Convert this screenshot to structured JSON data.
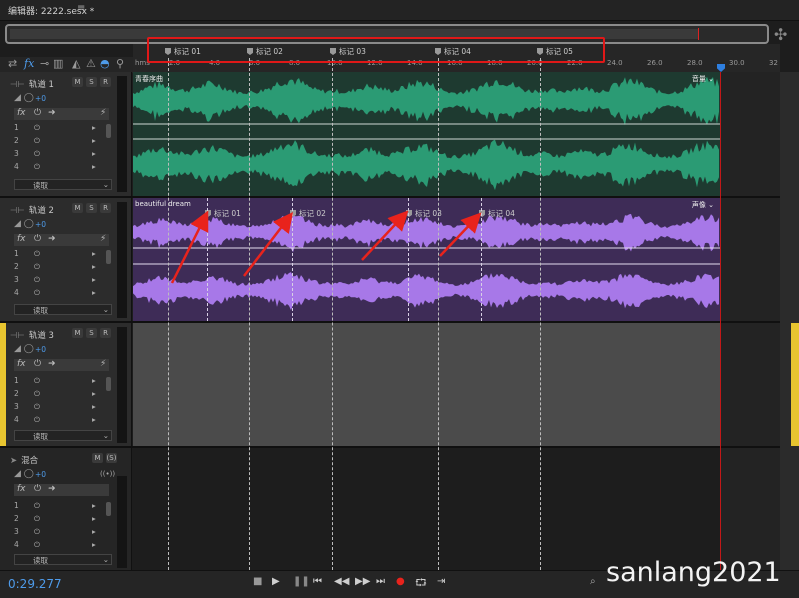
{
  "window": {
    "title": "编辑器: 2222.sesx *",
    "menu_icon": "hamburger-icon"
  },
  "timeline": {
    "unit": "hms",
    "ticks": [
      "2.0",
      "4.0",
      "6.0",
      "8.0",
      "10.0",
      "12.0",
      "14.0",
      "16.0",
      "18.0",
      "20.0",
      "22.0",
      "24.0",
      "26.0",
      "28.0",
      "30.0",
      "32"
    ]
  },
  "markers": [
    {
      "label": "标记 01"
    },
    {
      "label": "标记 02"
    },
    {
      "label": "标记 03"
    },
    {
      "label": "标记 04"
    },
    {
      "label": "标记 05"
    }
  ],
  "tracks": [
    {
      "name": "轨道 1",
      "volume": "+0",
      "buttons": [
        "M",
        "S",
        "R"
      ],
      "slots": [
        "1",
        "2",
        "3",
        "4"
      ],
      "read": "读取",
      "clip_label": "青春序曲",
      "clip_vol": "音量",
      "color": "#2b9b74",
      "bg": "#1f3a30"
    },
    {
      "name": "轨道 2",
      "volume": "+0",
      "buttons": [
        "M",
        "S",
        "R"
      ],
      "slots": [
        "1",
        "2",
        "3",
        "4"
      ],
      "read": "读取",
      "clip_label": "beautiful dream",
      "clip_vol": "声像",
      "color": "#a778e8",
      "bg": "#3e2c57",
      "clip_markers": [
        {
          "label": "标记 01"
        },
        {
          "label": "标记 02"
        },
        {
          "label": "标记 03"
        },
        {
          "label": "标记 04"
        }
      ]
    },
    {
      "name": "轨道 3",
      "volume": "+0",
      "buttons": [
        "M",
        "S",
        "R"
      ],
      "slots": [
        "1",
        "2",
        "3",
        "4"
      ],
      "read": "读取",
      "color": "#5a5a5a",
      "bg": "#4a4a4a"
    },
    {
      "name": "混合",
      "volume": "+0",
      "buttons": [
        "M",
        "(S)"
      ],
      "slots": [
        "1",
        "2",
        "3",
        "4"
      ],
      "read": "读取",
      "color": "#1e1e1e",
      "bg": "#1d1d1d"
    }
  ],
  "transport": {
    "time": "0:29.277",
    "controls": [
      "stop-icon",
      "play-icon",
      "pause-icon",
      "go-to-start-icon",
      "rewind-icon",
      "fast-forward-icon",
      "go-to-end-icon",
      "record-icon",
      "loop-icon",
      "skip-icon"
    ]
  },
  "watermark": "sanlang2021",
  "accent": "#4e9bea",
  "highlight": "#e01818"
}
